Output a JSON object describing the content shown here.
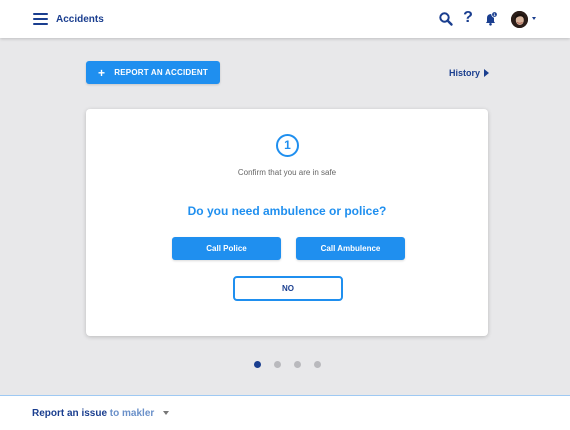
{
  "header": {
    "title": "Accidents",
    "notification_count": "1"
  },
  "actions": {
    "report_label": "REPORT AN ACCIDENT",
    "report_icon": "+",
    "history_label": "History"
  },
  "card": {
    "step_number": "1",
    "step_caption": "Confirm that you are in safe",
    "question": "Do you need ambulence or police?",
    "call_police_label": "Call Police",
    "call_ambulence_label": "Call Ambulence",
    "no_label": "NO"
  },
  "pagination": {
    "total": 4,
    "active_index": 0
  },
  "footer": {
    "link_prefix": "Report an",
    "link_issue": " issue",
    "link_rest": " to makler"
  },
  "colors": {
    "primary": "#1f8fef",
    "navy": "#1a3e8f",
    "background": "#e8e8ea"
  },
  "icons": [
    "menu-icon",
    "search-icon",
    "help-icon",
    "bell-icon",
    "avatar",
    "caret-down-icon",
    "caret-right-icon",
    "plus-icon"
  ]
}
